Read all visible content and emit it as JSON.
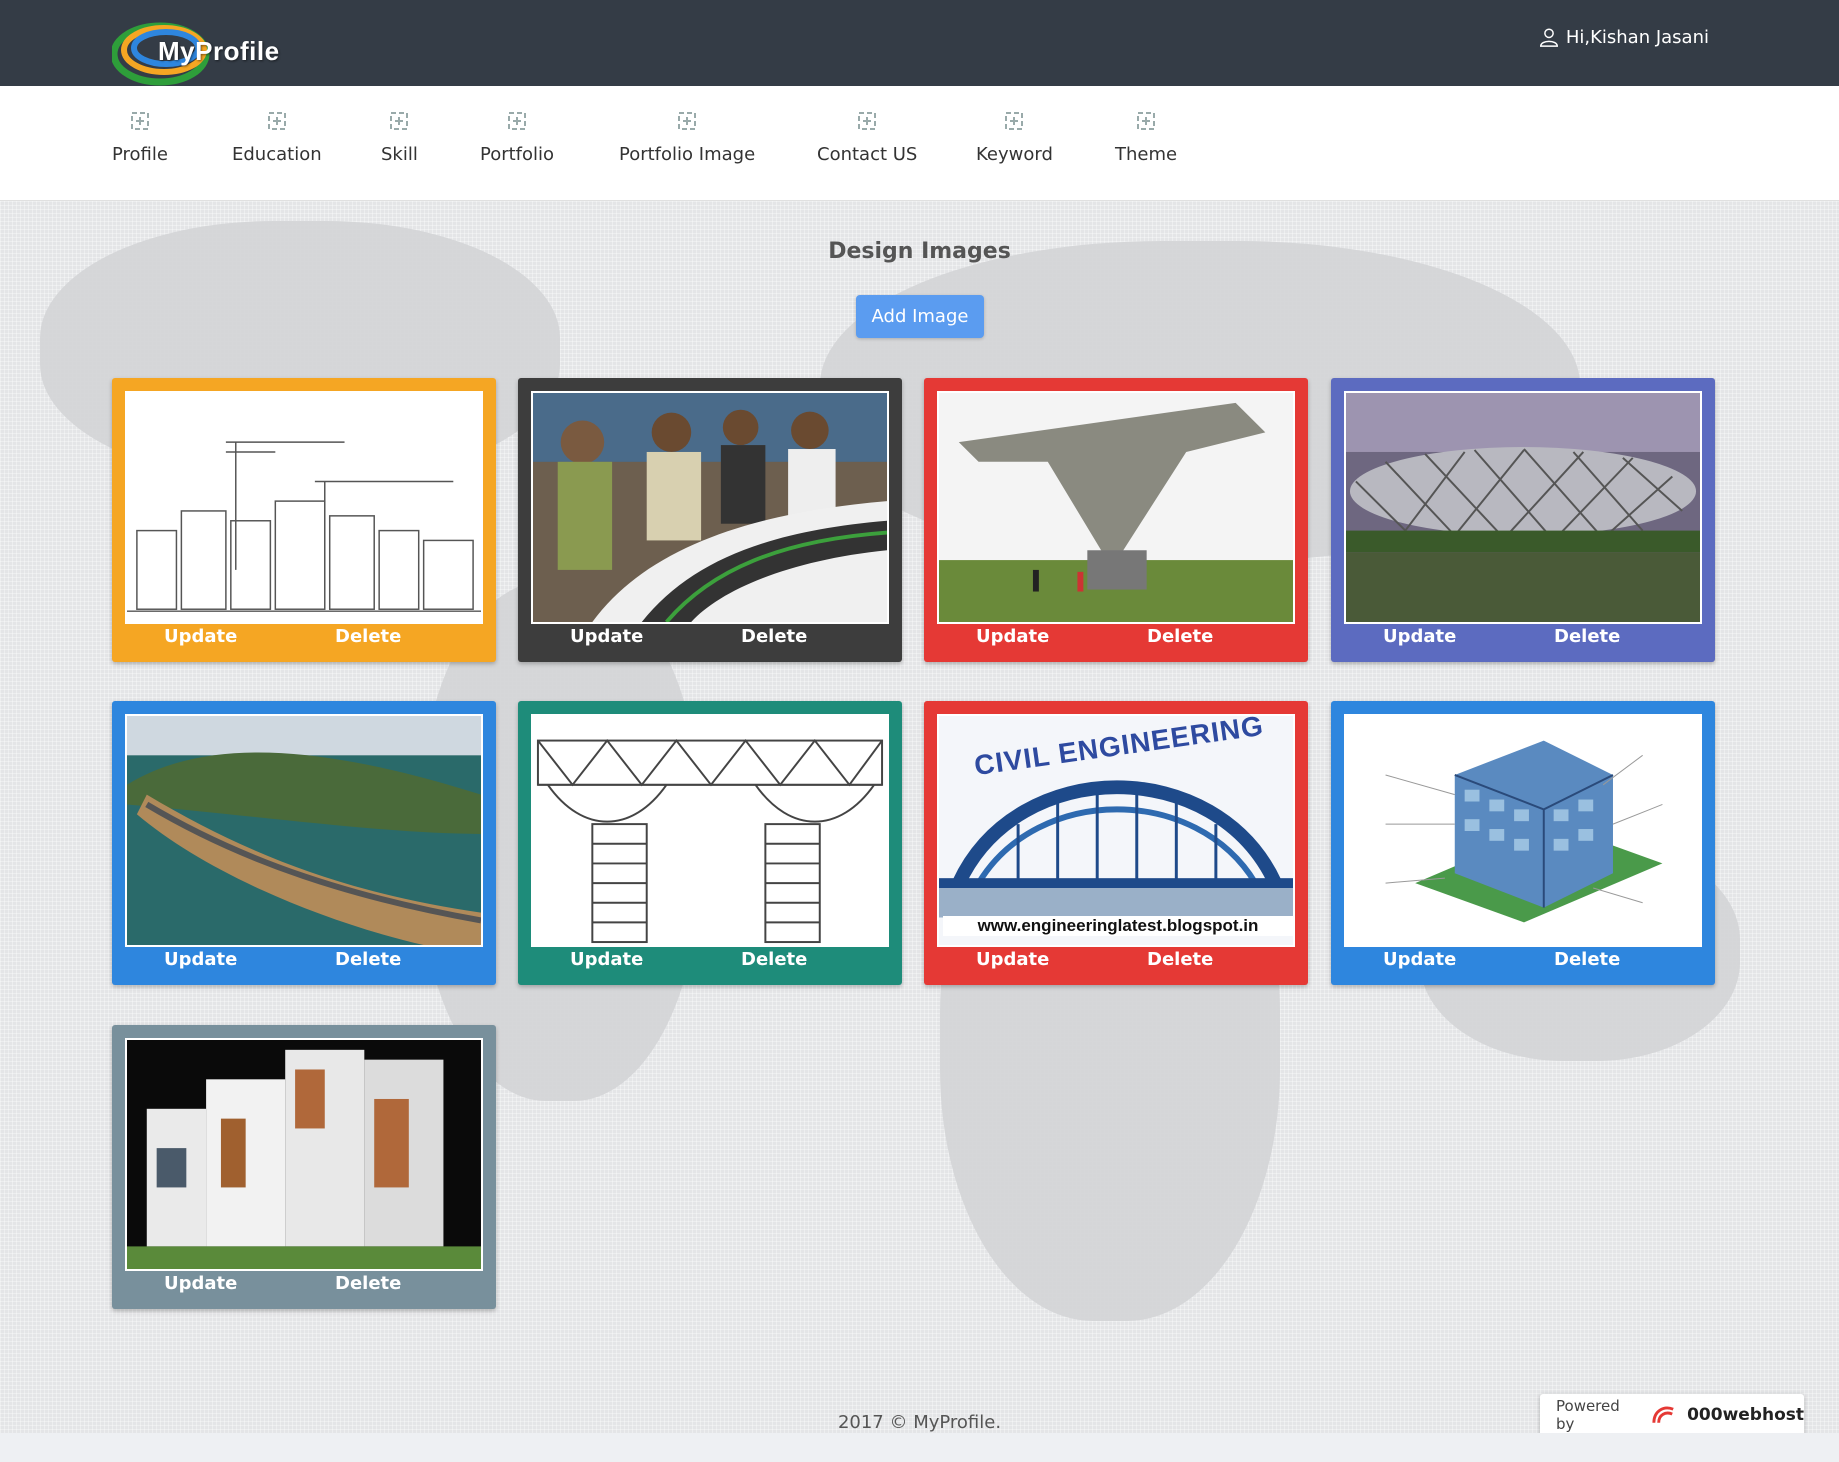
{
  "header": {
    "logo_text": "MyProfile",
    "user_greeting": "Hi,Kishan Jasani"
  },
  "nav": {
    "items": [
      {
        "label": "Profile",
        "icon": "plus-square-icon"
      },
      {
        "label": "Education",
        "icon": "plus-square-icon"
      },
      {
        "label": "Skill",
        "icon": "plus-square-icon"
      },
      {
        "label": "Portfolio",
        "icon": "plus-square-icon"
      },
      {
        "label": "Portfolio Image",
        "icon": "plus-square-icon"
      },
      {
        "label": "Contact US",
        "icon": "plus-square-icon"
      },
      {
        "label": "Keyword",
        "icon": "plus-square-icon"
      },
      {
        "label": "Theme",
        "icon": "plus-square-icon"
      }
    ]
  },
  "main": {
    "title": "Design Images",
    "add_button": "Add Image"
  },
  "cards": [
    {
      "color": "#f5a623",
      "update": "Update",
      "delete": "Delete",
      "image": "sketch-city-cranes"
    },
    {
      "color": "#3d3d3d",
      "update": "Update",
      "delete": "Delete",
      "image": "students-road-model"
    },
    {
      "color": "#e53935",
      "update": "Update",
      "delete": "Delete",
      "image": "concrete-pier"
    },
    {
      "color": "#5c6bc0",
      "update": "Update",
      "delete": "Delete",
      "image": "birds-nest-stadium"
    },
    {
      "color": "#2e86de",
      "update": "Update",
      "delete": "Delete",
      "image": "coastal-highway"
    },
    {
      "color": "#1e8c7a",
      "update": "Update",
      "delete": "Delete",
      "image": "truss-bridge-drawing"
    },
    {
      "color": "#e53935",
      "update": "Update",
      "delete": "Delete",
      "image": "civil-engineering-arch-bridge",
      "image_text_top": "CIVIL ENGINEERING",
      "image_text_bottom": "www.engineeringlatest.blogspot.in"
    },
    {
      "color": "#2e86de",
      "update": "Update",
      "delete": "Delete",
      "image": "building-services-diagram"
    },
    {
      "color": "#78909c",
      "update": "Update",
      "delete": "Delete",
      "image": "modern-house-render"
    }
  ],
  "footer": {
    "copyright": "2017 © MyProfile.",
    "powered_by": "Powered by",
    "host": "000webhost"
  }
}
